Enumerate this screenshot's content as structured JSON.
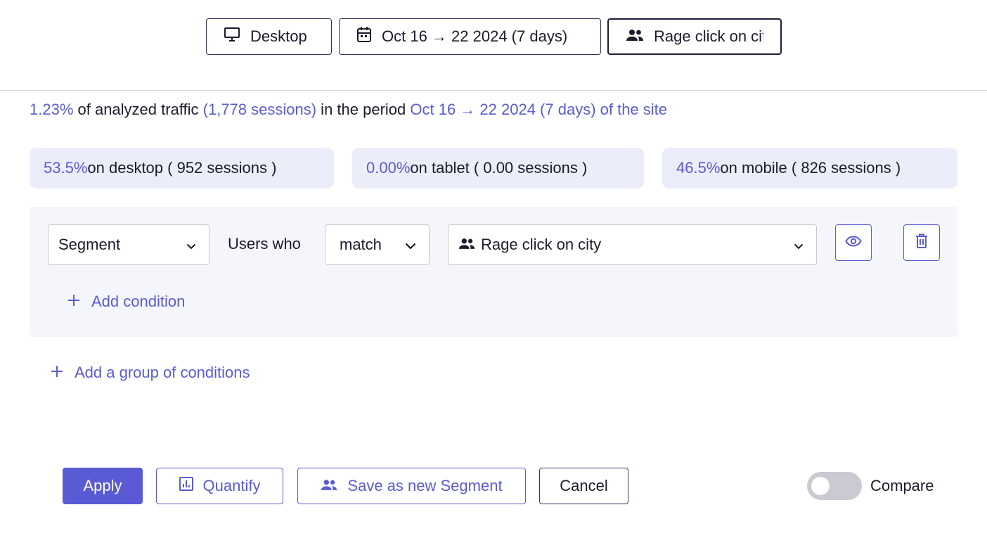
{
  "filters": {
    "device": "Desktop",
    "date_range": "Oct 16 → 22 2024 (7 days)",
    "segment": "Rage click on city"
  },
  "summary": {
    "percent": "1.23%",
    "text1": " of analyzed traffic ",
    "sessions": "(1,778 sessions)",
    "text2": " in the period ",
    "period": "Oct 16 → 22 2024 (7 days) of the site"
  },
  "devices": [
    {
      "percent": "53.5%",
      "label": " on desktop ( 952 sessions )"
    },
    {
      "percent": "0.00%",
      "label": " on tablet ( 0.00 sessions )"
    },
    {
      "percent": "46.5%",
      "label": " on mobile ( 826 sessions )"
    }
  ],
  "condition": {
    "type": "Segment",
    "users_who": "Users who",
    "operator": "match",
    "segment": "Rage click on city",
    "add_condition": "Add condition"
  },
  "add_group": "Add a group of conditions",
  "actions": {
    "apply": "Apply",
    "quantify": "Quantify",
    "save": "Save as new Segment",
    "cancel": "Cancel"
  },
  "compare": {
    "label": "Compare",
    "enabled": false
  },
  "colors": {
    "accent": "#5a5bd4",
    "pill_bg": "#ecedfb",
    "group_bg": "#f5f6fb"
  },
  "icons": [
    "monitor-icon",
    "calendar-icon",
    "users-icon",
    "chevron-down-icon",
    "eye-icon",
    "trash-icon",
    "plus-icon",
    "bar-chart-icon"
  ]
}
